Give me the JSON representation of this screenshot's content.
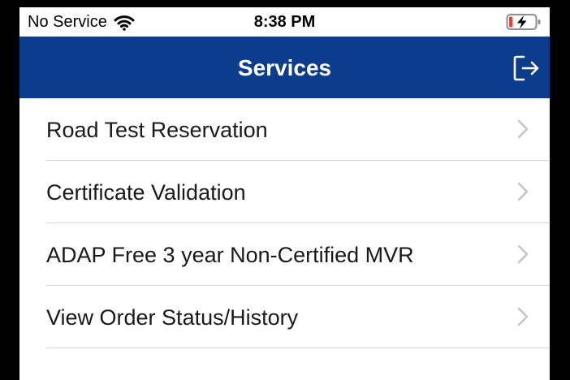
{
  "status_bar": {
    "carrier": "No Service",
    "time": "8:38 PM",
    "wifi_icon": "wifi-icon",
    "battery_icon": "battery-charging-icon"
  },
  "nav": {
    "title": "Services",
    "logout_icon": "logout-icon",
    "background_color": "#0c3d8c"
  },
  "services": [
    {
      "label": "Road Test Reservation"
    },
    {
      "label": "Certificate Validation"
    },
    {
      "label": "ADAP Free 3 year Non-Certified MVR"
    },
    {
      "label": "View Order Status/History"
    }
  ]
}
